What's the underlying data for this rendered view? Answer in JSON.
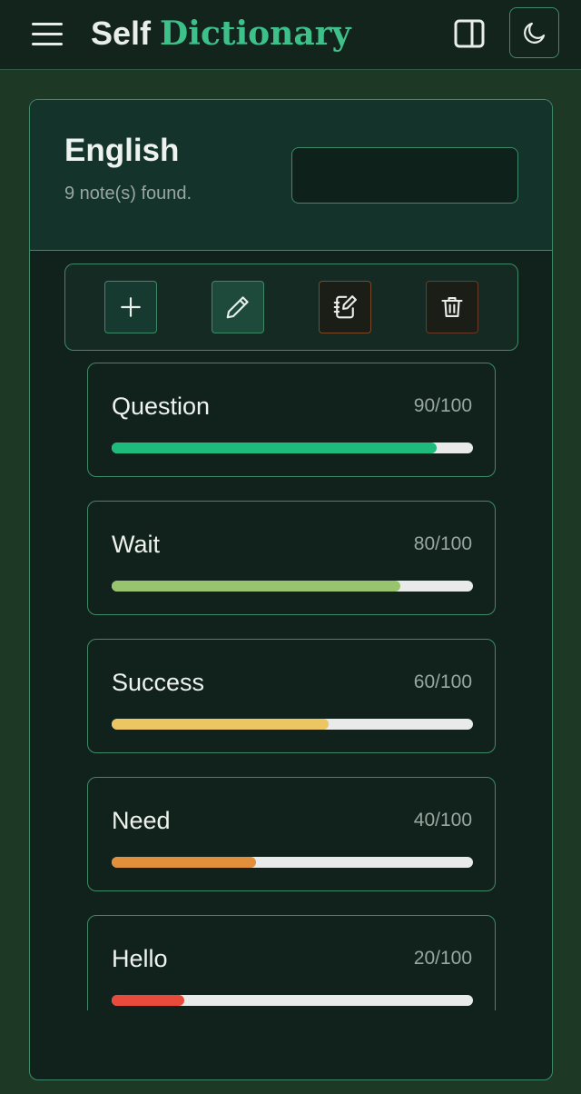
{
  "header": {
    "brand_part1": "Self",
    "brand_part2": "Dictionary",
    "accent_color": "#3ec08b",
    "menu_icon": "hamburger-menu-icon",
    "panel_icon": "sidebar-panel-icon",
    "theme_icon": "moon-icon"
  },
  "notebook": {
    "title": "English",
    "count_text": "9 note(s) found.",
    "search": {
      "value": "",
      "placeholder": "",
      "icon": "search-icon"
    }
  },
  "toolbar": {
    "buttons": [
      {
        "name": "add",
        "icon": "plus-icon"
      },
      {
        "name": "edit",
        "icon": "pencil-icon"
      },
      {
        "name": "notebook",
        "icon": "notebook-edit-icon"
      },
      {
        "name": "delete",
        "icon": "trash-icon"
      }
    ]
  },
  "notes": [
    {
      "word": "Question",
      "score_text": "90/100",
      "progress": 0.9,
      "color": "#1dbc7c"
    },
    {
      "word": "Wait",
      "score_text": "80/100",
      "progress": 0.8,
      "color": "#97c46c"
    },
    {
      "word": "Success",
      "score_text": "60/100",
      "progress": 0.6,
      "color": "#ebc662"
    },
    {
      "word": "Need",
      "score_text": "40/100",
      "progress": 0.4,
      "color": "#e28f3b"
    },
    {
      "word": "Hello",
      "score_text": "20/100",
      "progress": 0.2,
      "color": "#e84a3c"
    }
  ]
}
